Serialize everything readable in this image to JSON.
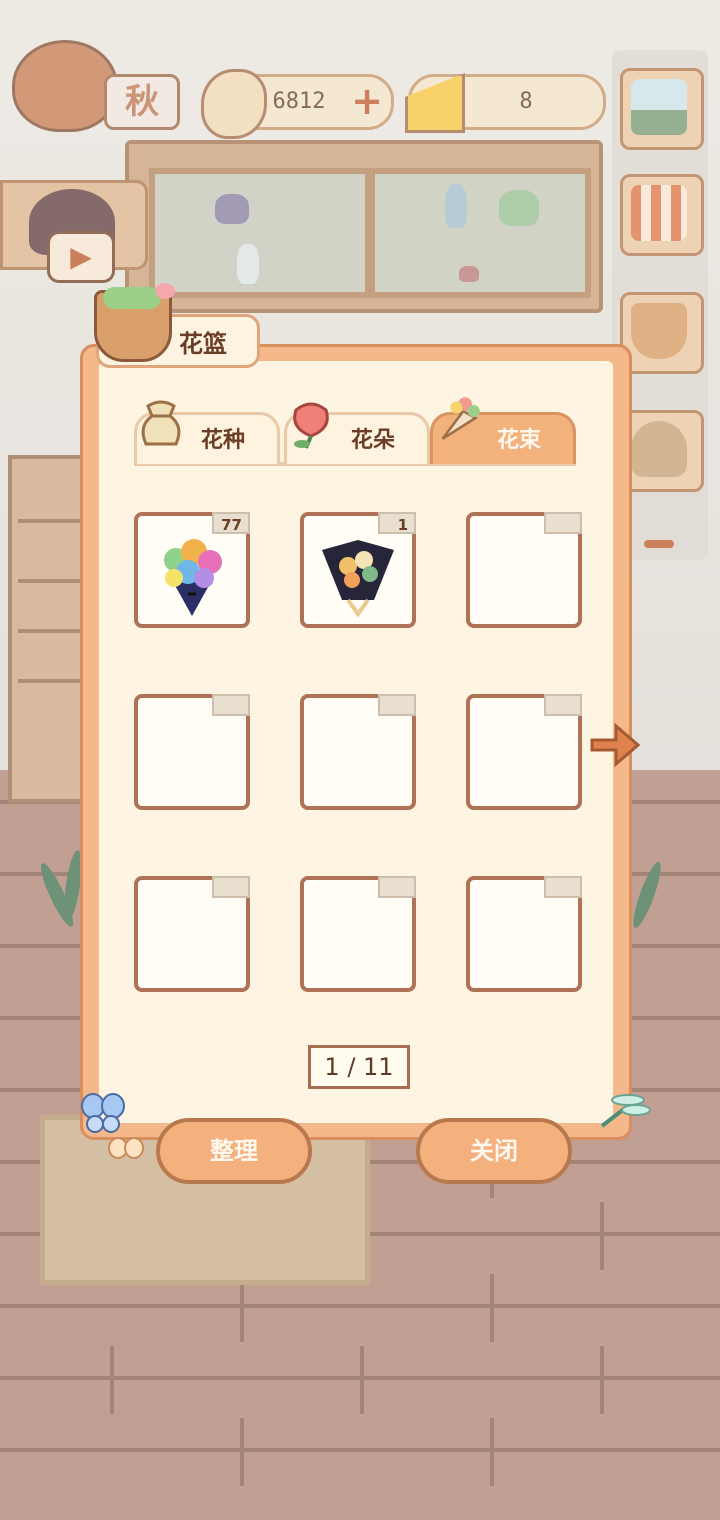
{
  "hud": {
    "season": "秋",
    "coins": "6812",
    "cheese": "8"
  },
  "dialog": {
    "title": "花篮",
    "tabs": [
      {
        "label": "花种",
        "active": false
      },
      {
        "label": "花朵",
        "active": false
      },
      {
        "label": "花束",
        "active": true
      }
    ],
    "slots": [
      {
        "filled": true,
        "count": "77",
        "item": "rainbow-bouquet"
      },
      {
        "filled": true,
        "count": "1",
        "item": "dark-wrapped-bouquet"
      },
      {
        "filled": false,
        "count": ""
      },
      {
        "filled": false,
        "count": ""
      },
      {
        "filled": false,
        "count": ""
      },
      {
        "filled": false,
        "count": ""
      },
      {
        "filled": false,
        "count": ""
      },
      {
        "filled": false,
        "count": ""
      },
      {
        "filled": false,
        "count": ""
      }
    ],
    "page": "1 / 11",
    "organize_label": "整理",
    "close_label": "关闭"
  },
  "colors": {
    "accent": "#f4b07d",
    "border": "#b07256",
    "panel": "#fdf5e2"
  }
}
